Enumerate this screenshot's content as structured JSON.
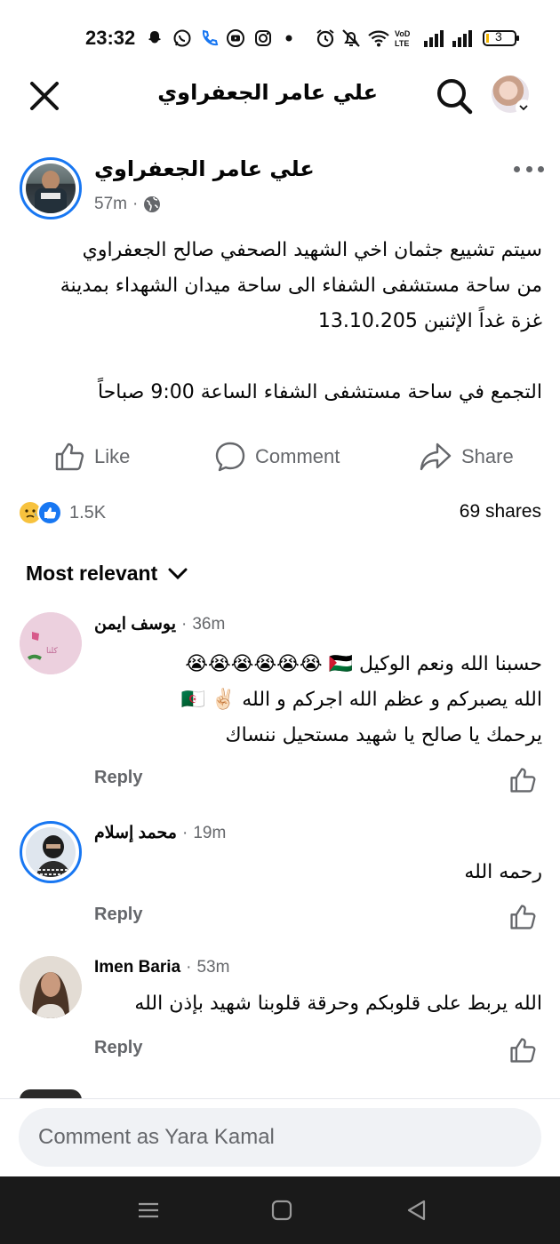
{
  "status_bar": {
    "time": "23:32",
    "battery": "3",
    "icons": [
      "snapchat-icon",
      "whatsapp-icon",
      "phone-icon",
      "youtube-icon",
      "instagram-icon",
      "dot-icon",
      "alarm-icon",
      "mute-icon",
      "wifi-icon",
      "volte-icon",
      "signal-icon",
      "signal-icon",
      "battery-icon"
    ],
    "volte_label": "VoD LTE"
  },
  "header": {
    "title": "علي عامر الجعفراوي"
  },
  "post": {
    "author": "علي عامر الجعفراوي",
    "time": "57m",
    "separator": "·",
    "body_lines": [
      "سيتم تشييع جثمان اخي الشهيد الصحفي صالح الجعفراوي",
      "من ساحة مستشفى الشفاء الى ساحة ميدان الشهداء بمدينة",
      "غزة غداً الإثنين 13.10.205"
    ],
    "body_extra": "التجمع في ساحة مستشفى الشفاء الساعة 9:00 صباحاً"
  },
  "actions": {
    "like": "Like",
    "comment": "Comment",
    "share": "Share"
  },
  "stats": {
    "reactions_count": "1.5K",
    "shares": "69 shares"
  },
  "sort": {
    "label": "Most relevant"
  },
  "comments": [
    {
      "name": "يوسف ايمن",
      "time": "36m",
      "lines": [
        "حسبنا الله ونعم الوكيل 🇵🇸 😭😭😭😭😭😭",
        "الله يصبركم و عظم الله اجركم و الله ✌🏻 🇩🇿",
        "يرحمك يا صالح يا شهيد مستحيل ننساك"
      ],
      "reply": "Reply"
    },
    {
      "name": "محمد إسلام",
      "time": "19m",
      "lines": [
        "رحمه الله"
      ],
      "reply": "Reply"
    },
    {
      "name": "Imen Baria",
      "time": "53m",
      "lines": [
        "الله يربط على قلوبكم وحرقة قلوبنا شهيد بإذن الله"
      ],
      "reply": "Reply"
    }
  ],
  "composer": {
    "placeholder": "Comment as Yara Kamal"
  },
  "colors": {
    "accent": "#1877f2",
    "secondary_text": "#65676b",
    "composer_bg": "#f0f2f5",
    "nav_bg": "#1a1a1a"
  }
}
